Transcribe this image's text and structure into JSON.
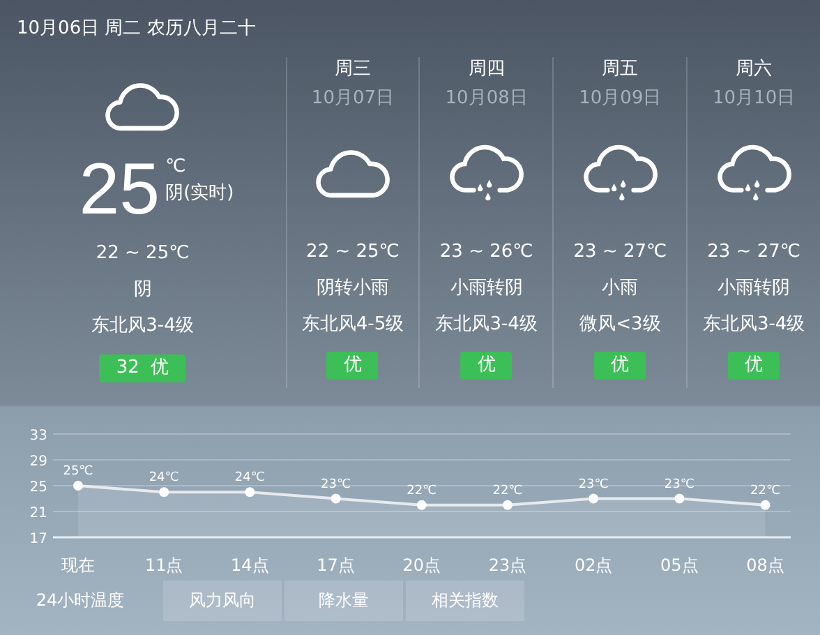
{
  "header": {
    "date_line": "10月06日 周二 农历八月二十"
  },
  "today": {
    "kind": "cloudy",
    "temperature": "25",
    "unit": "℃",
    "condition_now": "阴(实时)",
    "range": "22 ~ 25℃",
    "condition": "阴",
    "wind": "东北风3-4级",
    "aqi": "32  优"
  },
  "forecast": [
    {
      "weekday": "周三",
      "date": "10月07日",
      "kind": "cloudy",
      "range": "22 ~ 25℃",
      "condition": "阴转小雨",
      "wind": "东北风4-5级",
      "aqi": "优"
    },
    {
      "weekday": "周四",
      "date": "10月08日",
      "kind": "rain",
      "range": "23 ~ 26℃",
      "condition": "小雨转阴",
      "wind": "东北风3-4级",
      "aqi": "优"
    },
    {
      "weekday": "周五",
      "date": "10月09日",
      "kind": "rain",
      "range": "23 ~ 27℃",
      "condition": "小雨",
      "wind": "微风<3级",
      "aqi": "优"
    },
    {
      "weekday": "周六",
      "date": "10月10日",
      "kind": "rain",
      "range": "23 ~ 27℃",
      "condition": "小雨转阴",
      "wind": "东北风3-4级",
      "aqi": "优"
    }
  ],
  "hourly": {
    "chart_data": {
      "type": "area",
      "categories": [
        "现在",
        "11点",
        "14点",
        "17点",
        "20点",
        "23点",
        "02点",
        "05点",
        "08点"
      ],
      "grid": true,
      "series": [
        {
          "color": "#ffffff",
          "values": [
            25,
            24,
            24,
            23,
            22,
            22,
            23,
            23,
            22
          ]
        }
      ],
      "value_labels": [
        "25℃",
        "24℃",
        "24℃",
        "23℃",
        "22℃",
        "22℃",
        "23℃",
        "23℃",
        "22℃"
      ],
      "yticks": [
        33,
        29,
        25,
        21,
        17
      ],
      "ylim": [
        17,
        33
      ]
    }
  },
  "tabs": [
    {
      "label": "24小时温度",
      "selected": true
    },
    {
      "label": "风力风向",
      "selected": false
    },
    {
      "label": "降水量",
      "selected": false
    },
    {
      "label": "相关指数",
      "selected": false
    }
  ]
}
